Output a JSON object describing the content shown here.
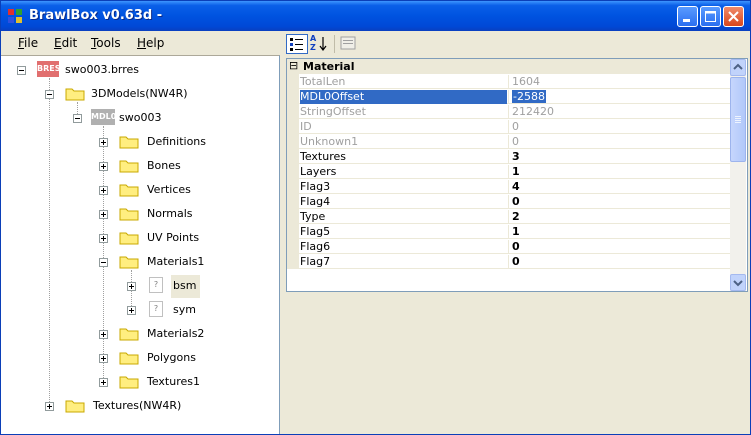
{
  "window": {
    "title": "BrawlBox v0.63d -",
    "colors": {
      "titlebar": "#0053e0",
      "selection": "#316ac5"
    }
  },
  "menu": {
    "items": [
      {
        "mnemonic": "F",
        "rest": "ile"
      },
      {
        "mnemonic": "E",
        "rest": "dit"
      },
      {
        "mnemonic": "T",
        "rest": "ools"
      },
      {
        "mnemonic": "H",
        "rest": "elp"
      }
    ]
  },
  "tree": {
    "root": {
      "badge": "BRES",
      "label": "swo003.brres"
    },
    "models": {
      "label": "3DModels(NW4R)"
    },
    "mdl": {
      "badge": "MDL0",
      "label": "swo003"
    },
    "groups": [
      "Definitions",
      "Bones",
      "Vertices",
      "Normals",
      "UV Points",
      "Materials1"
    ],
    "materials": [
      {
        "badge": "?",
        "label": "bsm",
        "selected": true
      },
      {
        "badge": "?",
        "label": "sym",
        "selected": false
      }
    ],
    "groups_after": [
      "Materials2",
      "Polygons",
      "Textures1"
    ],
    "textures": {
      "label": "Textures(NW4R)"
    }
  },
  "toolbar": {
    "icons": [
      "categorized-icon",
      "alphabetical-sort-icon",
      "property-pages-icon"
    ],
    "sort_letters": [
      "A",
      "Z"
    ]
  },
  "grid": {
    "category": "Material",
    "collapse_glyph": "⊟",
    "rows": [
      {
        "name": "TotalLen",
        "value": "1604",
        "readonly": true
      },
      {
        "name": "MDL0Offset",
        "value": "-2588",
        "readonly": false,
        "selected": true
      },
      {
        "name": "StringOffset",
        "value": "212420",
        "readonly": true
      },
      {
        "name": "ID",
        "value": "0",
        "readonly": true
      },
      {
        "name": "Unknown1",
        "value": "0",
        "readonly": true
      },
      {
        "name": "Textures",
        "value": "3",
        "readonly": false
      },
      {
        "name": "Layers",
        "value": "1",
        "readonly": false
      },
      {
        "name": "Flag3",
        "value": "4",
        "readonly": false
      },
      {
        "name": "Flag4",
        "value": "0",
        "readonly": false
      },
      {
        "name": "Type",
        "value": "2",
        "readonly": false
      },
      {
        "name": "Flag5",
        "value": "1",
        "readonly": false
      },
      {
        "name": "Flag6",
        "value": "0",
        "readonly": false
      },
      {
        "name": "Flag7",
        "value": "0",
        "readonly": false
      }
    ]
  }
}
